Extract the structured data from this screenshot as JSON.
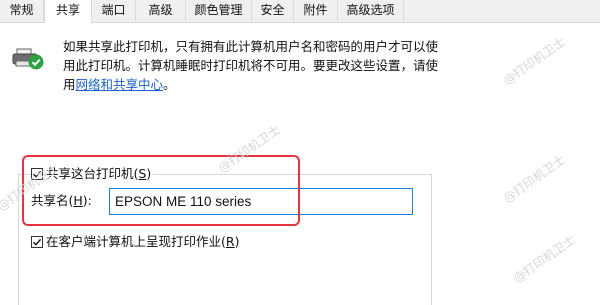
{
  "tabs": [
    {
      "label": "常规",
      "active": false
    },
    {
      "label": "共享",
      "active": true
    },
    {
      "label": "端口",
      "active": false
    },
    {
      "label": "高级",
      "active": false
    },
    {
      "label": "颜色管理",
      "active": false
    },
    {
      "label": "安全",
      "active": false
    },
    {
      "label": "附件",
      "active": false
    },
    {
      "label": "高级选项",
      "active": false
    }
  ],
  "description": {
    "line1": "如果共享此打印机，只有拥有此计算机用户名和密码的用户才可以使",
    "line2": "用此打印机。计算机睡眠时打印机将不可用。要更改这些设置，请使",
    "line3_prefix": "用",
    "link": "网络和共享中心",
    "line3_suffix": "。"
  },
  "share_checkbox": {
    "label": "共享这台打印机(",
    "accel": "S",
    "label_end": ")",
    "checked": true
  },
  "share_name": {
    "label": "共享名(",
    "accel": "H",
    "label_end": "):",
    "value": "EPSON ME 110 series"
  },
  "render_checkbox": {
    "label": "在客户端计算机上呈现打印作业(",
    "accel": "R",
    "label_end": ")",
    "checked": true
  },
  "watermark": "@打印机卫士",
  "colors": {
    "link": "#1a62c8",
    "highlight_box": "#e4353f",
    "input_border": "#1e7fd8"
  }
}
